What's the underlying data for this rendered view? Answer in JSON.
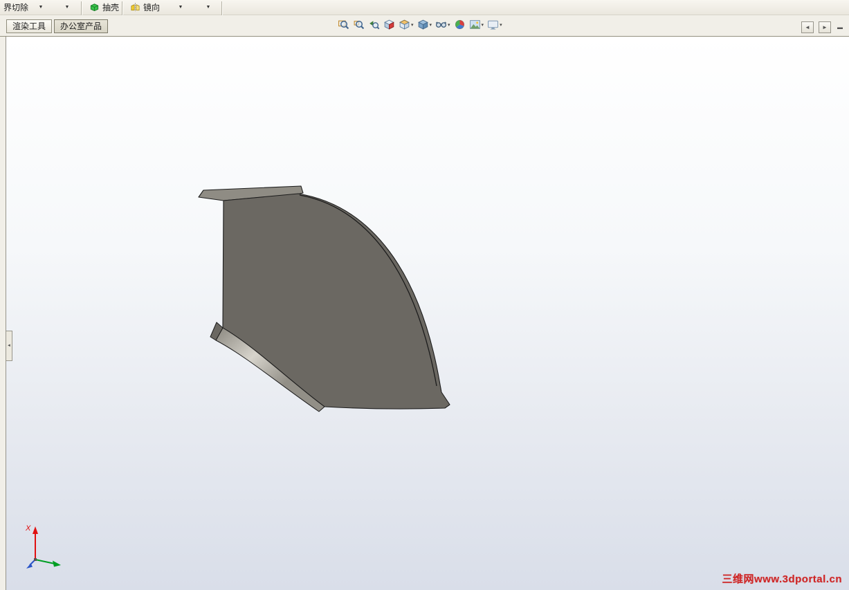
{
  "toolbar": {
    "cut_label": "界切除",
    "flyout_arrow": "▼",
    "shell_label": "抽壳",
    "mirror_label": "镜向"
  },
  "tabs": [
    {
      "label": "渲染工具",
      "active": false
    },
    {
      "label": "办公室产品",
      "active": true
    }
  ],
  "view_toolbar": {
    "caret": "▾",
    "icons": [
      {
        "name": "zoom-fit-icon",
        "dropdown": false
      },
      {
        "name": "zoom-area-icon",
        "dropdown": false
      },
      {
        "name": "previous-view-icon",
        "dropdown": false
      },
      {
        "name": "section-view-icon",
        "dropdown": false
      },
      {
        "name": "view-orientation-icon",
        "dropdown": true
      },
      {
        "name": "display-style-icon",
        "dropdown": true
      },
      {
        "name": "hide-show-items-icon",
        "dropdown": true
      },
      {
        "name": "edit-appearance-icon",
        "dropdown": false
      },
      {
        "name": "apply-scene-icon",
        "dropdown": true
      },
      {
        "name": "view-settings-icon",
        "dropdown": true
      }
    ]
  },
  "corner_buttons": [
    {
      "name": "collapse-pane-left-button",
      "glyph": "◄"
    },
    {
      "name": "collapse-pane-right-button",
      "glyph": "►"
    },
    {
      "name": "minimize-toolbar-button",
      "glyph": "▬"
    }
  ],
  "viewport": {
    "watermark": "三维网www.3dportal.cn",
    "watermark_color": "#cf2626",
    "left_panel_tab_glyph": "◄",
    "triad": {
      "x_label": "X",
      "x_color": "#e01010",
      "y_color": "#009e23",
      "z_color": "#2a55c8"
    }
  },
  "model": {
    "face_color": "#6b6862",
    "flange_top_color": "#8f8c84",
    "band_base_color": "#928f87",
    "band_highlight_color": "#d7d4cc",
    "edge_color": "#1c1c1c"
  },
  "colors": {
    "toolbar_bg": "#f1efe8",
    "viewport_top": "#ffffff",
    "viewport_bottom": "#d9dee9"
  }
}
